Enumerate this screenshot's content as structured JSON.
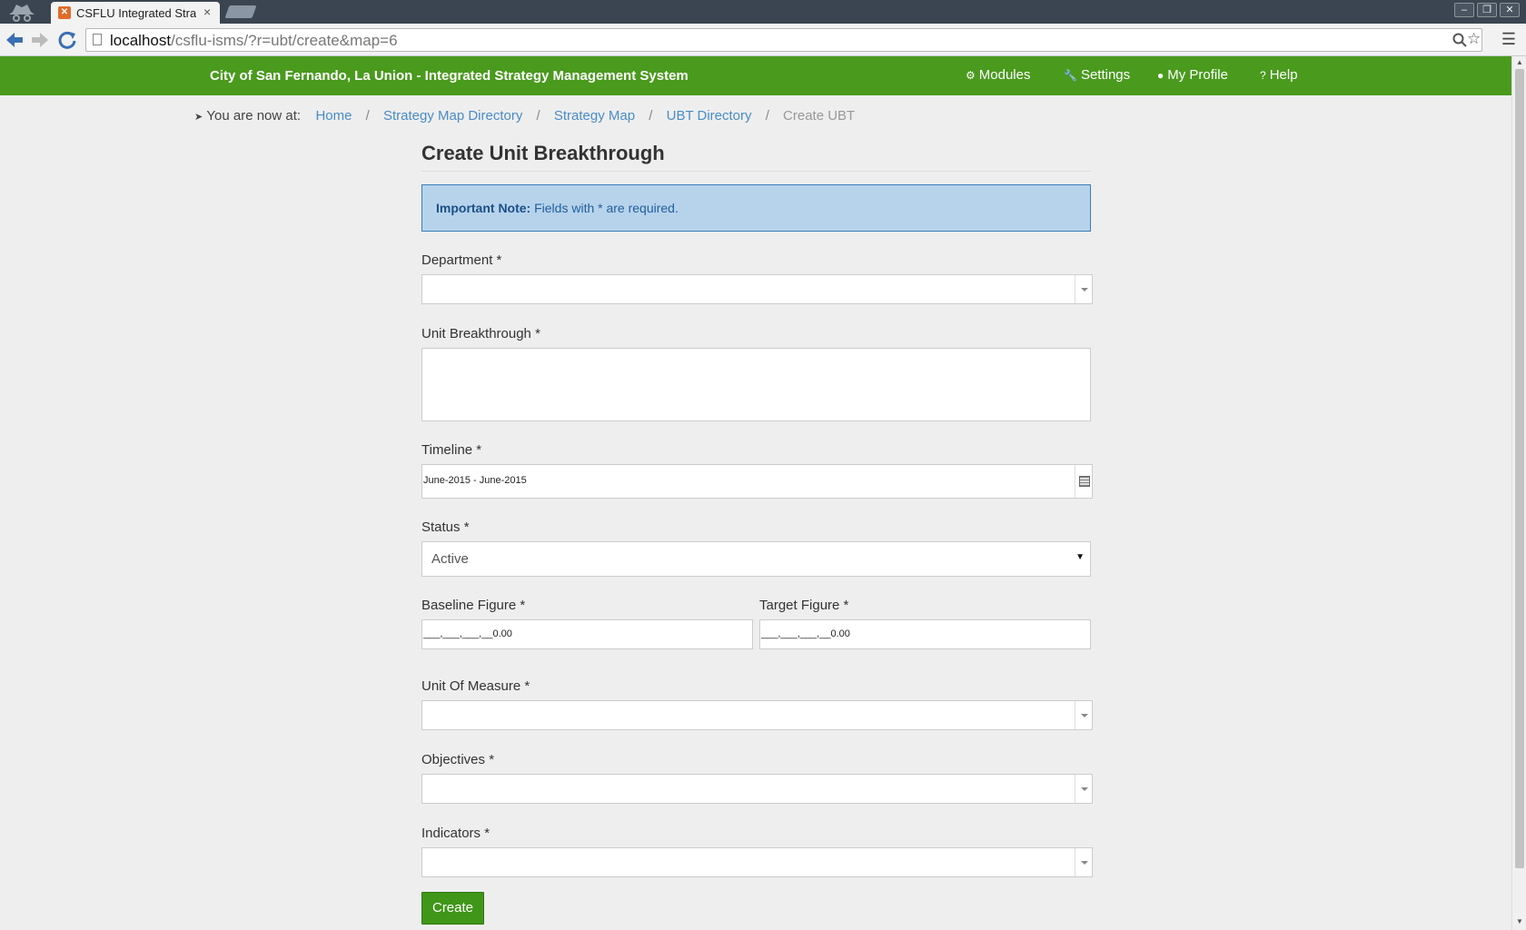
{
  "browser": {
    "tab_title": "CSFLU Integrated Stra",
    "tab_close": "×",
    "url_host": "localhost",
    "url_path": "/csflu-isms/?r=ubt/create&map=6"
  },
  "navbar": {
    "brand": "City of San Fernando, La Union - Integrated Strategy Management System",
    "items": [
      {
        "label": "Modules",
        "icon": "cogs-icon"
      },
      {
        "label": "Settings",
        "icon": "wrench-icon"
      },
      {
        "label": "My Profile",
        "icon": "user-icon"
      },
      {
        "label": "Help",
        "icon": "question-circle-icon"
      }
    ]
  },
  "breadcrumb": {
    "prefix": "You are now at:",
    "links": [
      "Home",
      "Strategy Map Directory",
      "Strategy Map",
      "UBT Directory"
    ],
    "separator": "/",
    "active": "Create UBT"
  },
  "form": {
    "title": "Create Unit Breakthrough",
    "note_strong": "Important Note:",
    "note_text": " Fields with * are required.",
    "department_label": "Department *",
    "ubt_label": "Unit Breakthrough *",
    "timeline_label": "Timeline *",
    "timeline_value": "June-2015 - June-2015",
    "status_label": "Status *",
    "status_value": "Active",
    "baseline_label": "Baseline Figure *",
    "baseline_value": "___,___,___,__0.00",
    "target_label": "Target Figure *",
    "target_value": "___,___,___,__0.00",
    "uom_label": "Unit Of Measure *",
    "objectives_label": "Objectives *",
    "indicators_label": "Indicators *",
    "submit_label": "Create"
  },
  "colors": {
    "navbar": "#4a9a1e",
    "link": "#4a8cc7",
    "alert_bg": "#b7d3ec",
    "button": "#3f9618"
  }
}
